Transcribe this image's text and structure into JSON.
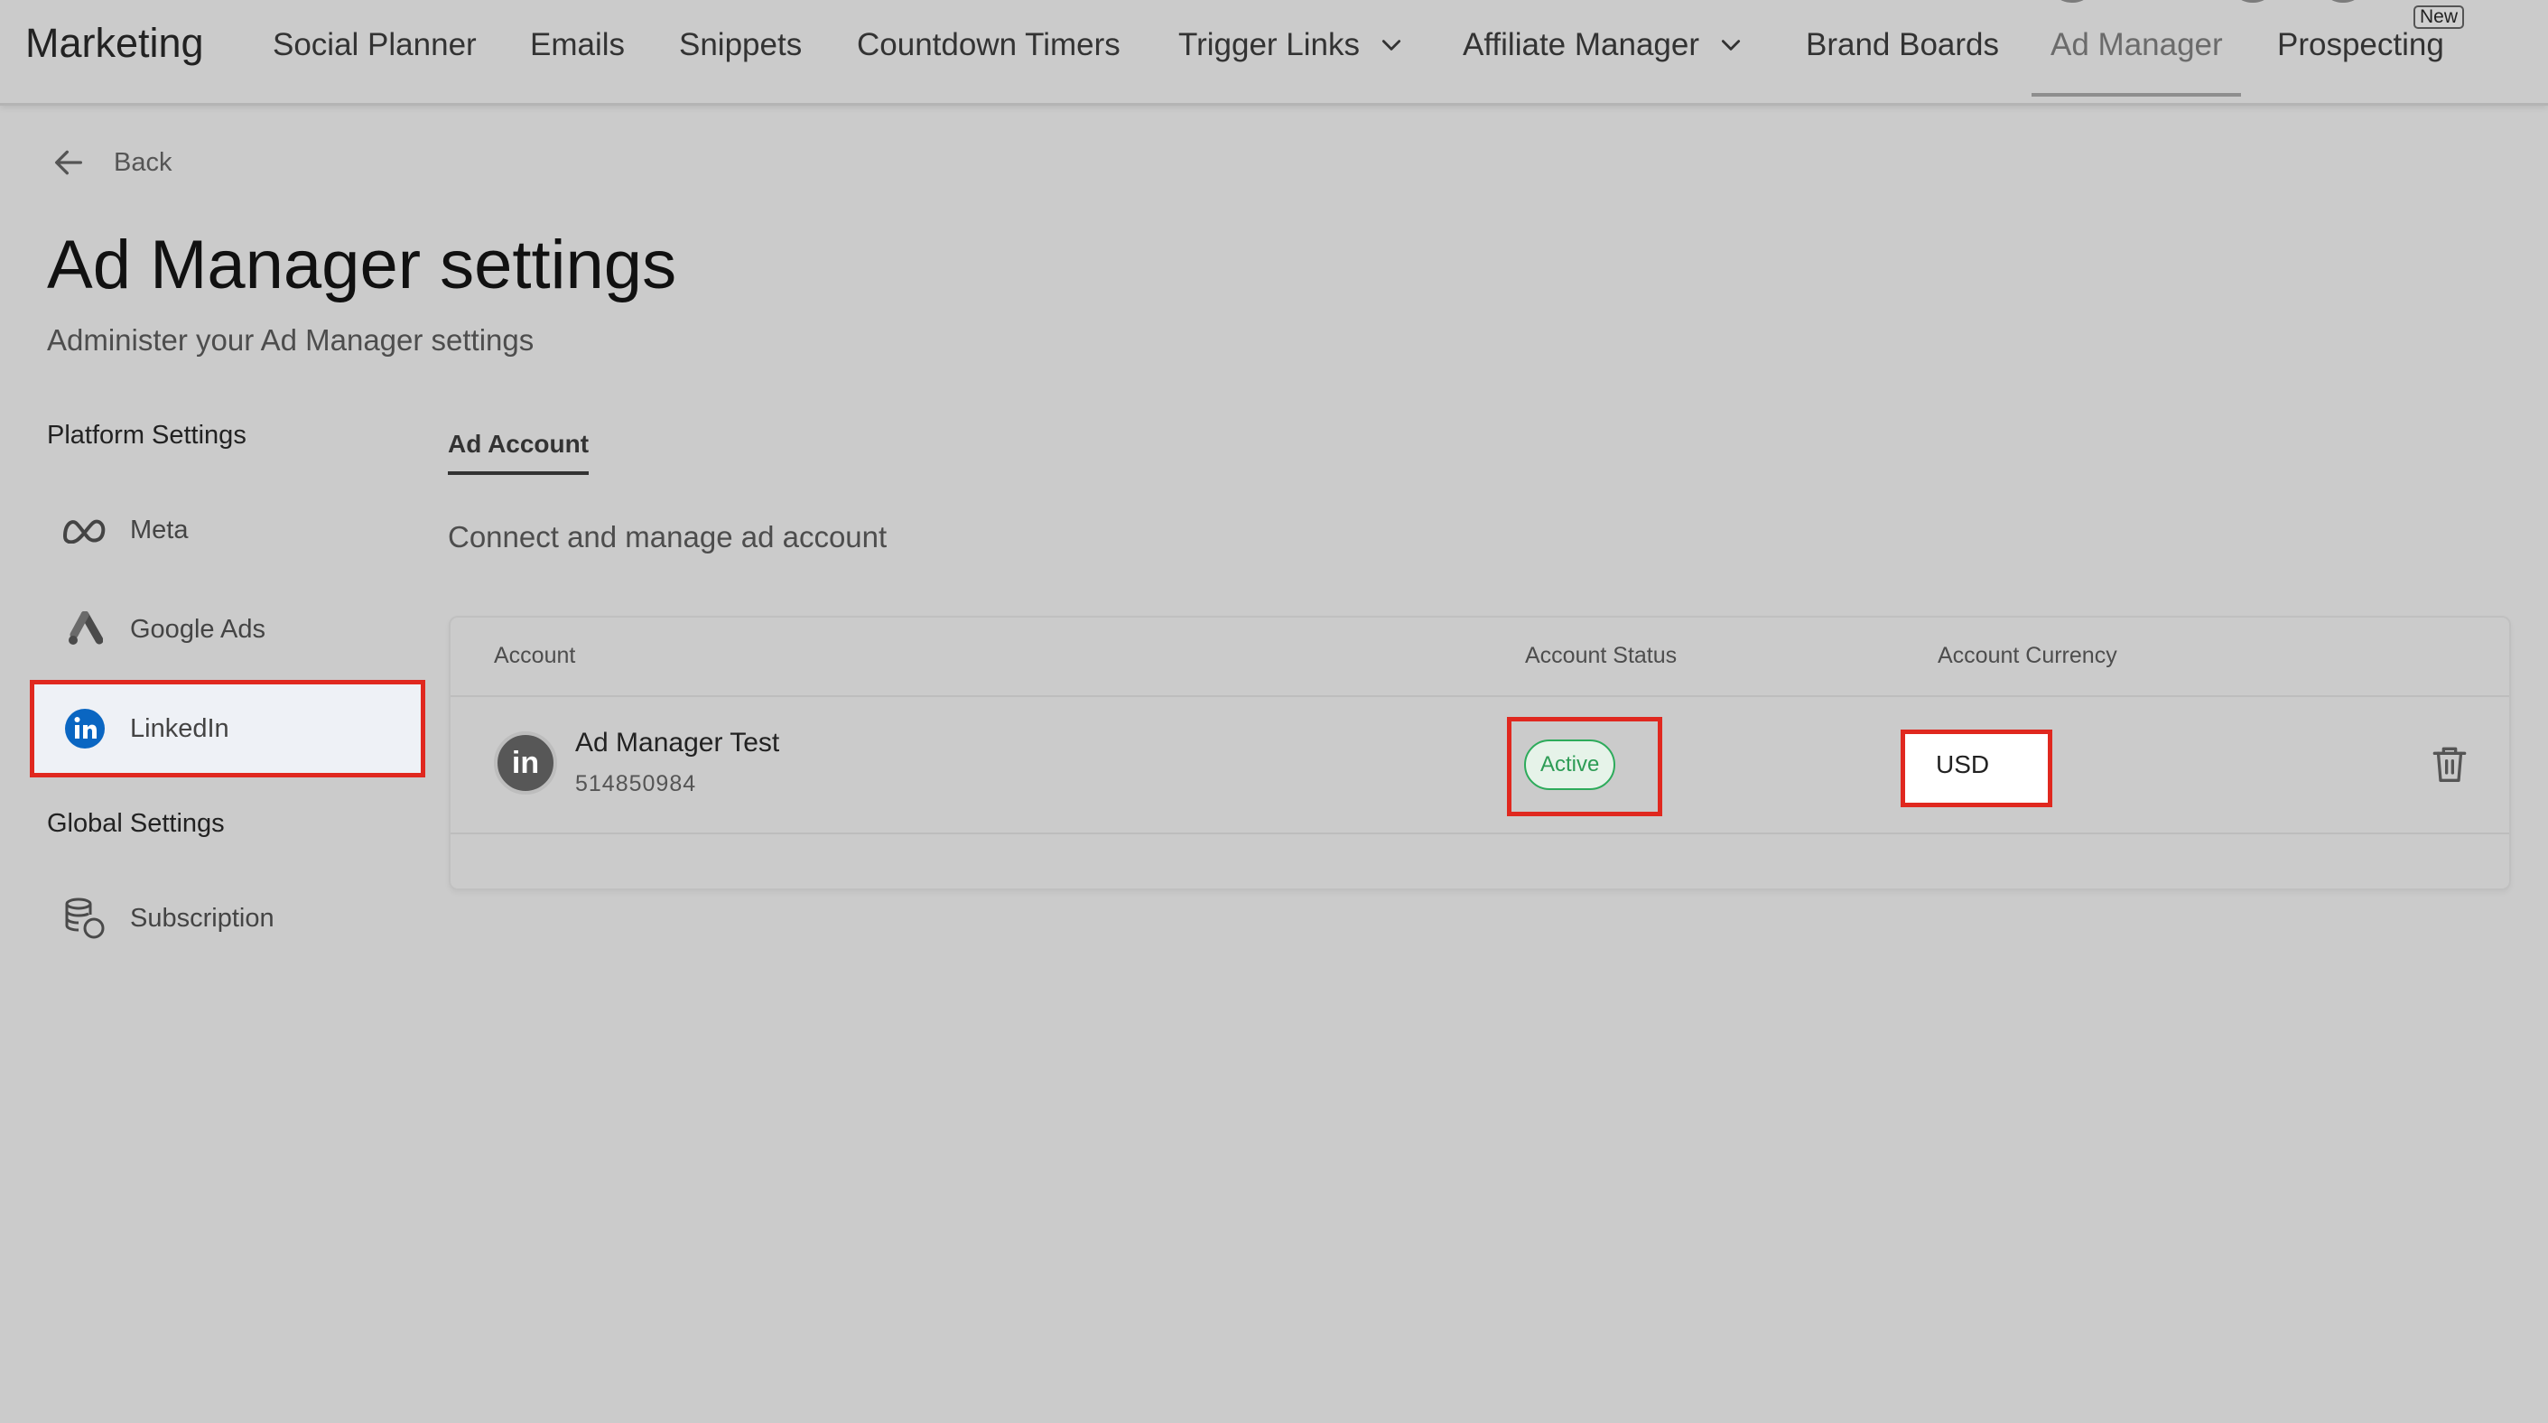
{
  "app": {
    "brand": "Marketing"
  },
  "nav": {
    "items": [
      {
        "label": "Social Planner"
      },
      {
        "label": "Emails"
      },
      {
        "label": "Snippets"
      },
      {
        "label": "Countdown Timers"
      },
      {
        "label": "Trigger Links",
        "has_dropdown": true
      },
      {
        "label": "Affiliate Manager",
        "has_dropdown": true
      },
      {
        "label": "Brand Boards"
      },
      {
        "label": "Ad Manager",
        "active": true
      },
      {
        "label": "Prospecting",
        "badge": "New"
      }
    ]
  },
  "header": {
    "back_label": "Back",
    "title": "Ad Manager settings",
    "subtitle": "Administer your Ad Manager settings"
  },
  "sidebar": {
    "platform_label": "Platform Settings",
    "platform_items": [
      {
        "label": "Meta",
        "icon": "meta-icon"
      },
      {
        "label": "Google Ads",
        "icon": "google-ads-icon"
      },
      {
        "label": "LinkedIn",
        "icon": "linkedin-icon",
        "selected": true
      }
    ],
    "global_label": "Global Settings",
    "global_items": [
      {
        "label": "Subscription",
        "icon": "subscription-icon"
      }
    ]
  },
  "content": {
    "tab_label": "Ad Account",
    "description": "Connect and manage ad account",
    "table": {
      "headers": [
        "Account",
        "Account Status",
        "Account Currency"
      ],
      "rows": [
        {
          "avatar_text": "in",
          "name": "Ad Manager Test",
          "id": "514850984",
          "status": "Active",
          "currency": "USD"
        }
      ]
    }
  },
  "colors": {
    "highlight": "#e0281f",
    "active_green": "#2d9c55",
    "linkedin_blue": "#0a66c2",
    "background": "#cbcbcb"
  }
}
